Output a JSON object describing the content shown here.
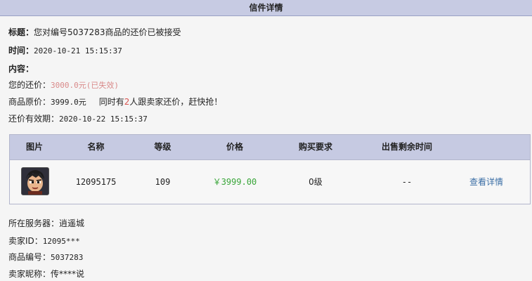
{
  "window": {
    "title": "信件详情"
  },
  "letter": {
    "subject_label": "标题：",
    "subject": "您对编号5037283商品的还价已被接受",
    "time_label": "时间：",
    "time": "2020-10-21 15:15:37",
    "content_label": "内容：",
    "offer_label": "您的还价：",
    "offer_value": "3000.0元(已失效)",
    "original_label": "商品原价：",
    "original_value": "3999.0元",
    "notice_prefix": "同时有",
    "notice_count": "2",
    "notice_suffix": "人跟卖家还价，赶快抢！",
    "validity_label": "还价有效期：",
    "validity_value": "2020-10-22 15:15:37"
  },
  "table": {
    "headers": [
      "图片",
      "名称",
      "等级",
      "价格",
      "购买要求",
      "出售剩余时间"
    ],
    "row": {
      "avatar_icon": "character-portrait-icon",
      "name": "12095175",
      "level": "109",
      "price": "￥3999.00",
      "requirement": "0级",
      "remaining": "--",
      "action": "查看详情"
    }
  },
  "footer": {
    "server_label": "所在服务器：",
    "server": "逍遥城",
    "seller_id_label": "卖家ID：",
    "seller_id": "12095***",
    "item_no_label": "商品编号：",
    "item_no": "5037283",
    "nickname_label": "卖家昵称：",
    "nickname": "传****说"
  },
  "colors": {
    "titlebar": "#c7cbe3",
    "table_header": "#c6cae2",
    "price_green": "#3aa63a",
    "expired_red": "#d98a8a",
    "link_blue": "#3a6ea5"
  }
}
